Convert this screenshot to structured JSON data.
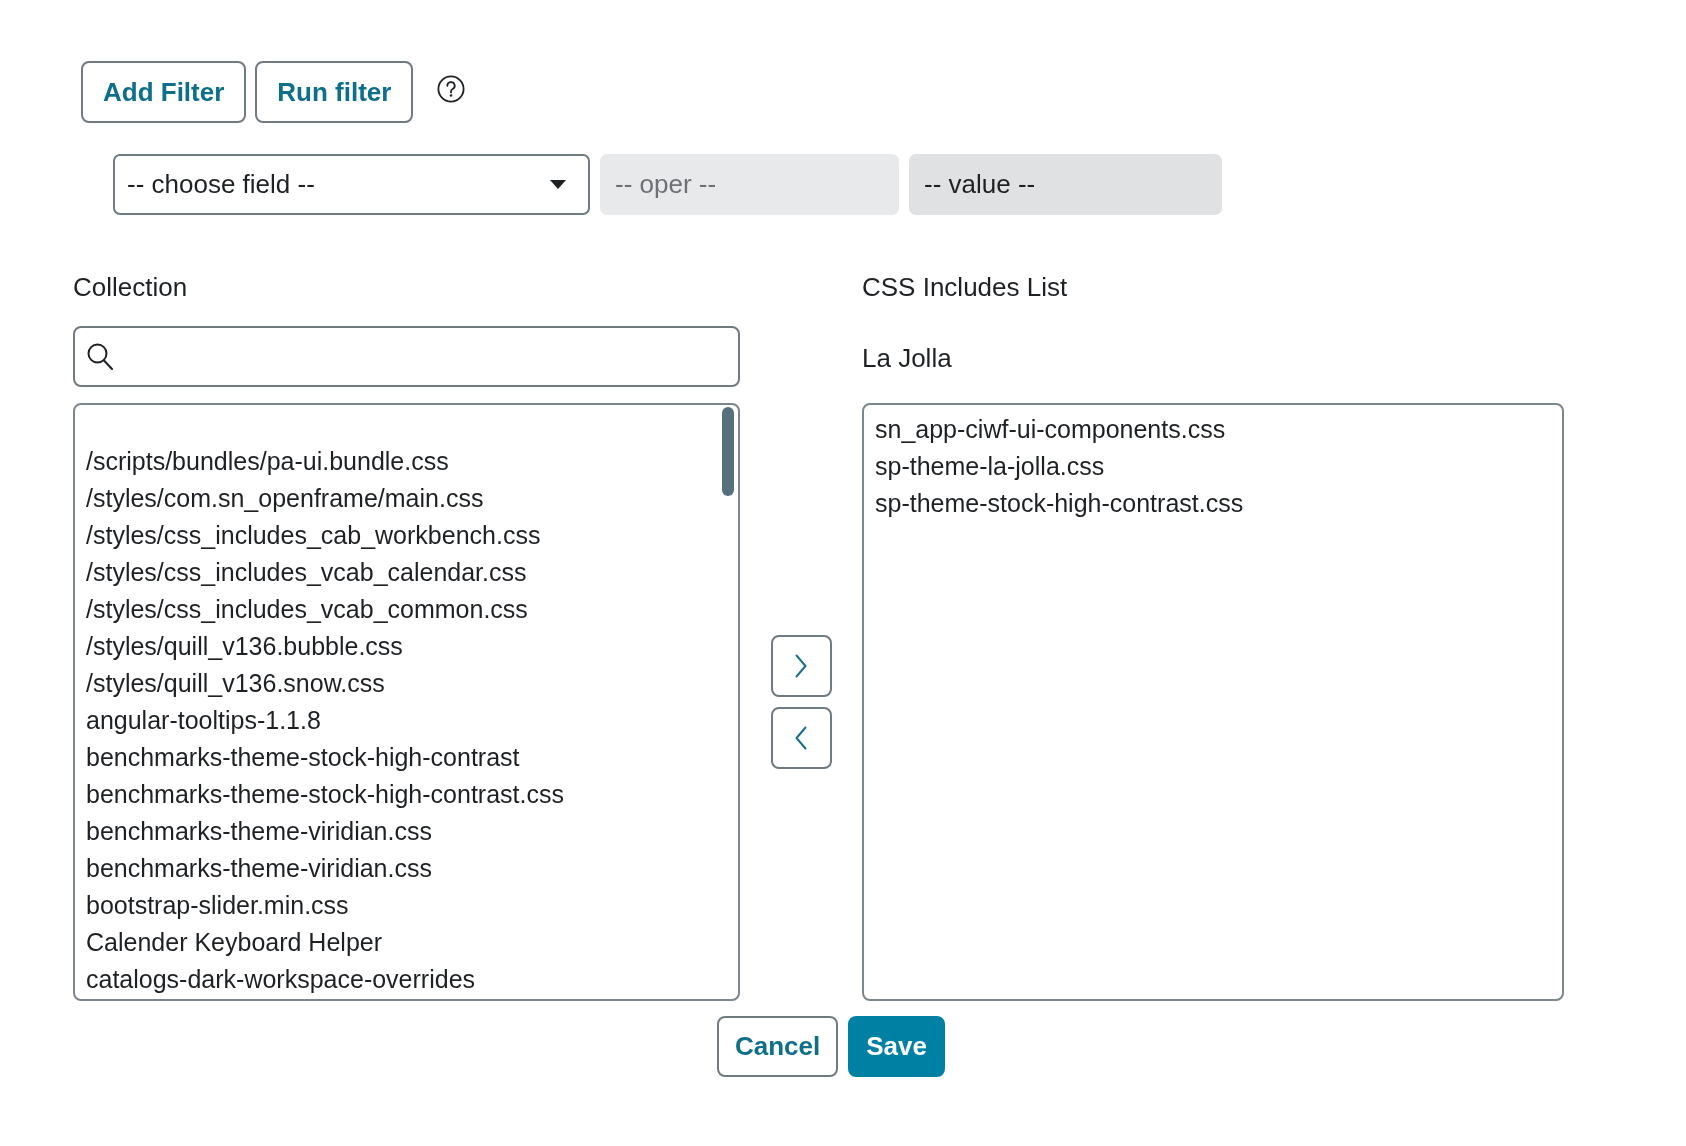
{
  "toolbar": {
    "buttons": [
      {
        "label": "Add Filter",
        "kind": "secondary"
      },
      {
        "label": "Run filter",
        "kind": "secondary"
      }
    ]
  },
  "filter_row": {
    "field": {
      "value": "-- choose field --"
    },
    "operator": {
      "value": "-- oper --",
      "disabled": true
    },
    "value": {
      "value": "-- value --",
      "readonly": true
    }
  },
  "collection": {
    "title": "Collection",
    "items": [
      {
        "label": "/scripts/bundles/pa-ui.bundle.css",
        "selected": false
      },
      {
        "label": "/styles/com.sn_openframe/main.css",
        "selected": false
      },
      {
        "label": "/styles/css_includes_cab_workbench.css",
        "selected": false
      },
      {
        "label": "/styles/css_includes_vcab_calendar.css",
        "selected": false
      },
      {
        "label": "/styles/css_includes_vcab_common.css",
        "selected": false
      },
      {
        "label": "/styles/quill_v136.bubble.css",
        "selected": false
      },
      {
        "label": "/styles/quill_v136.snow.css",
        "selected": false
      },
      {
        "label": "angular-tooltips-1.1.8",
        "selected": false
      },
      {
        "label": "benchmarks-theme-stock-high-contrast",
        "selected": false
      },
      {
        "label": "benchmarks-theme-stock-high-contrast.css",
        "selected": false
      },
      {
        "label": "benchmarks-theme-viridian.css",
        "selected": false
      },
      {
        "label": "benchmarks-theme-viridian.css",
        "selected": false
      },
      {
        "label": "bootstrap-slider.min.css",
        "selected": false
      },
      {
        "label": "Calender Keyboard Helper",
        "selected": false
      },
      {
        "label": "catalogs-dark-workspace-overrides",
        "selected": false
      }
    ]
  },
  "includes": {
    "title": "CSS Includes List",
    "subtitle": "La Jolla",
    "items": [
      {
        "label": "sn_app-ciwf-ui-components.css",
        "selected": false
      },
      {
        "label": "sp-theme-la-jolla.css",
        "selected": false
      },
      {
        "label": "sp-theme-stock-high-contrast.css",
        "selected": false
      }
    ]
  },
  "footer": {
    "buttons": [
      {
        "label": "Cancel",
        "kind": "secondary"
      },
      {
        "label": "Save",
        "kind": "primary"
      }
    ]
  }
}
